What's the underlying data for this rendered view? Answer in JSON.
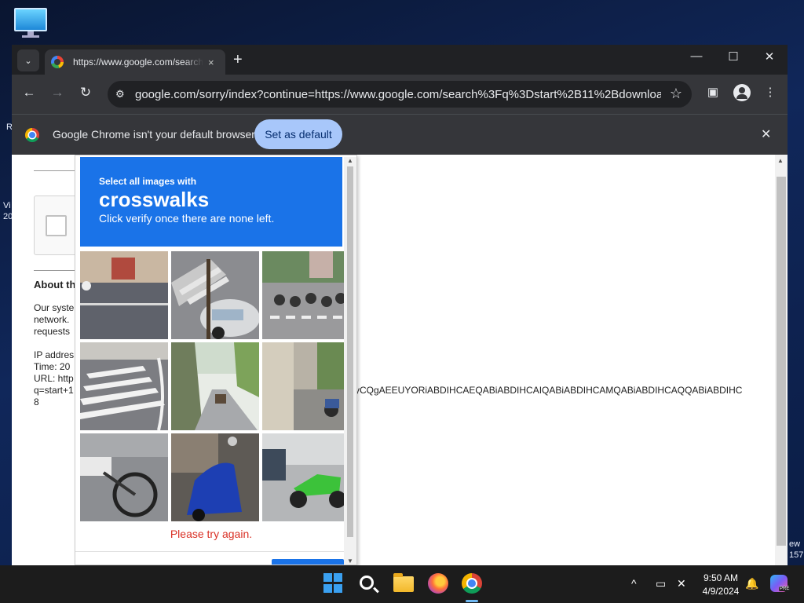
{
  "desktop": {
    "icon": "monitor-icon",
    "edge_left": [
      "R",
      "Vi",
      "20"
    ],
    "edge_right": [
      "ew",
      "157"
    ]
  },
  "browser": {
    "tab": {
      "favicon": "google-favicon",
      "title": "https://www.google.com/search",
      "close_icon": "×"
    },
    "new_tab_icon": "+",
    "window_controls": {
      "minimize": "—",
      "maximize": "☐",
      "close": "✕"
    },
    "toolbar": {
      "back_icon": "←",
      "forward_icon": "→",
      "reload_icon": "↻",
      "site_info_icon": "⚙",
      "url": "google.com/sorry/index?continue=https://www.google.com/search%3Fq%3Dstart%2B11%2Bdownload%2...",
      "bookmark_icon": "☆",
      "side_panel_icon": "▣",
      "menu_icon": "⋮"
    },
    "infobar": {
      "message": "Google Chrome isn't your default browser",
      "button": "Set as default",
      "close_icon": "✕"
    }
  },
  "page": {
    "about_heading": "About th",
    "para1": [
      "Our syste",
      "network.",
      "requests"
    ],
    "para2": [
      "IP addres",
      "Time: 20",
      "URL: http",
      "q=start+1",
      "8"
    ],
    "long_line": "yCQgAEEUYORiABDIHCAEQABiABDIHCAIQABiABDIHCAMQABiABDIHCAQQABiABDIHC"
  },
  "captcha": {
    "select_text": "Select all images with",
    "target": "crosswalks",
    "instruction": "Click verify once there are none left.",
    "tiles": [
      "street-corner",
      "car-crosswalk",
      "scooters-crosswalk",
      "crosswalk-lines",
      "road-trees",
      "alley-motorcycle",
      "bicycle",
      "blue-scooter",
      "green-motorcycle"
    ],
    "retry_text": "Please try again."
  },
  "taskbar": {
    "clock_time": "9:50 AM",
    "clock_date": "4/9/2024",
    "tray_chevron": "^",
    "notification_icon": "🔔",
    "pre_badge": "PRE"
  }
}
